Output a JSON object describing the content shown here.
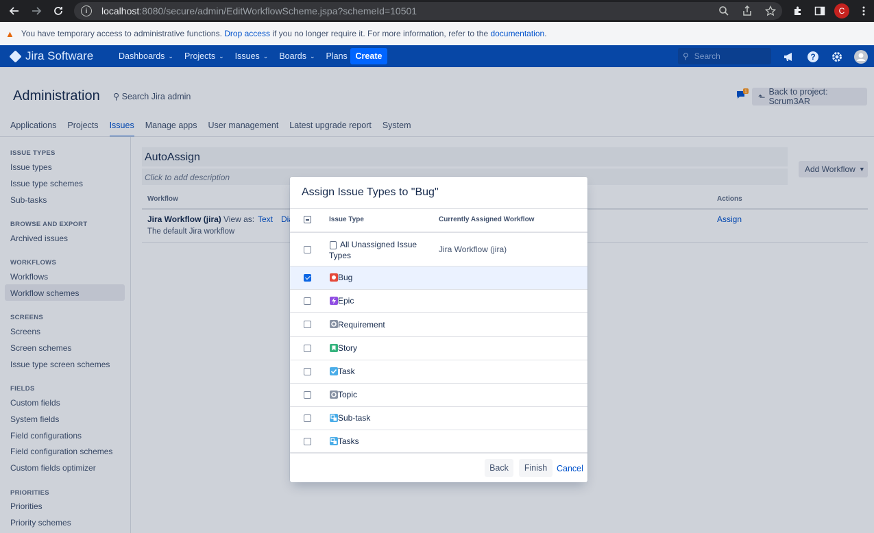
{
  "browser": {
    "url_host": "localhost",
    "url_rest": ":8080/secure/admin/EditWorkflowScheme.jspa?schemeId=10501",
    "info": "i",
    "profile_initial": "C"
  },
  "banner": {
    "text1": "You have temporary access to administrative functions.",
    "link1": "Drop access",
    "text2": " if you no longer require it. For more information, refer to the ",
    "link2": "documentation",
    "text3": "."
  },
  "header": {
    "logo": "Jira Software",
    "nav": [
      "Dashboards",
      "Projects",
      "Issues",
      "Boards",
      "Plans"
    ],
    "create": "Create",
    "search_placeholder": "Search"
  },
  "admin": {
    "title": "Administration",
    "search": "Search Jira admin",
    "feedback_count": "1",
    "back_to_project": "Back to project: Scrum3AR",
    "tabs": [
      "Applications",
      "Projects",
      "Issues",
      "Manage apps",
      "User management",
      "Latest upgrade report",
      "System"
    ],
    "active_tab": "Issues"
  },
  "sidebar": {
    "sections": [
      {
        "heading": "ISSUE TYPES",
        "items": [
          "Issue types",
          "Issue type schemes",
          "Sub-tasks"
        ]
      },
      {
        "heading": "BROWSE AND EXPORT",
        "items": [
          "Archived issues"
        ]
      },
      {
        "heading": "WORKFLOWS",
        "items": [
          "Workflows",
          "Workflow schemes"
        ]
      },
      {
        "heading": "SCREENS",
        "items": [
          "Screens",
          "Screen schemes",
          "Issue type screen schemes"
        ]
      },
      {
        "heading": "FIELDS",
        "items": [
          "Custom fields",
          "System fields",
          "Field configurations",
          "Field configuration schemes",
          "Custom fields optimizer"
        ]
      },
      {
        "heading": "PRIORITIES",
        "items": [
          "Priorities",
          "Priority schemes"
        ]
      }
    ],
    "selected": "Workflow schemes"
  },
  "scheme": {
    "name": "AutoAssign",
    "description_placeholder": "Click to add description",
    "add_workflow": "Add Workflow",
    "col_workflow": "Workflow",
    "col_actions": "Actions",
    "workflow_name": "Jira Workflow (jira)",
    "view_as": "View as:",
    "view_text": "Text",
    "view_diagram_partial": "Dia",
    "workflow_desc": "The default Jira workflow",
    "assign": "Assign"
  },
  "dialog": {
    "title": "Assign Issue Types to \"Bug\"",
    "col_issue_type": "Issue Type",
    "col_current": "Currently Assigned Workflow",
    "rows": [
      {
        "label": "All Unassigned Issue Types",
        "current": "Jira Workflow (jira)",
        "checked": false,
        "icon": "copy-icon",
        "color": "#ffffff"
      },
      {
        "label": "Bug",
        "current": "",
        "checked": true,
        "icon": "bug-icon",
        "color": "#e5493a"
      },
      {
        "label": "Epic",
        "current": "",
        "checked": false,
        "icon": "epic-icon",
        "color": "#904ee2"
      },
      {
        "label": "Requirement",
        "current": "",
        "checked": false,
        "icon": "requirement-icon",
        "color": "#8993a4"
      },
      {
        "label": "Story",
        "current": "",
        "checked": false,
        "icon": "story-icon",
        "color": "#36b37e"
      },
      {
        "label": "Task",
        "current": "",
        "checked": false,
        "icon": "task-icon",
        "color": "#4bade8"
      },
      {
        "label": "Topic",
        "current": "",
        "checked": false,
        "icon": "topic-icon",
        "color": "#8993a4"
      },
      {
        "label": "Sub-task",
        "current": "",
        "checked": false,
        "icon": "subtask-icon",
        "color": "#4bade8"
      },
      {
        "label": "Tasks",
        "current": "",
        "checked": false,
        "icon": "subtask-icon",
        "color": "#4bade8"
      }
    ],
    "back": "Back",
    "finish": "Finish",
    "cancel": "Cancel"
  }
}
